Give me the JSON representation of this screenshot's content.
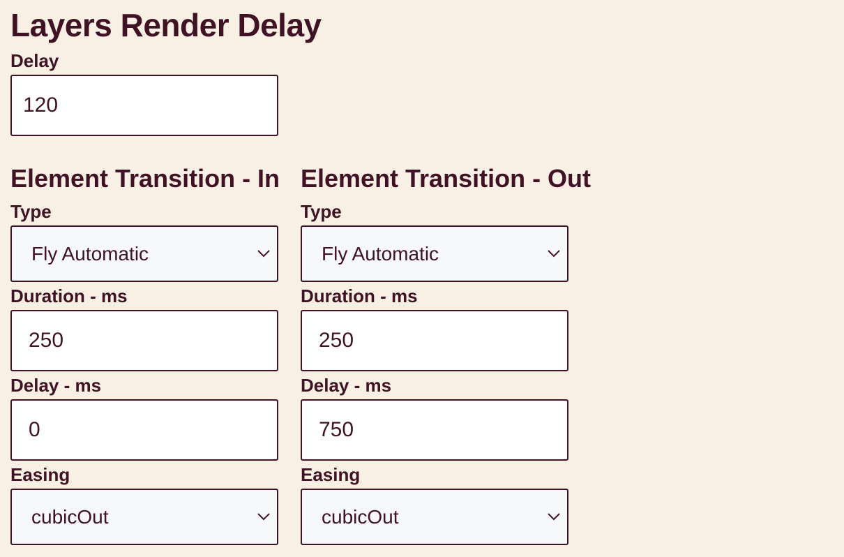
{
  "page_title": "Layers Render Delay",
  "render_delay": {
    "label": "Delay",
    "value": "120"
  },
  "transition_in": {
    "title": "Element Transition - In",
    "type_label": "Type",
    "type_value": "Fly Automatic",
    "duration_label": "Duration - ms",
    "duration_value": "250",
    "delay_label": "Delay - ms",
    "delay_value": "0",
    "easing_label": "Easing",
    "easing_value": "cubicOut"
  },
  "transition_out": {
    "title": "Element Transition - Out",
    "type_label": "Type",
    "type_value": "Fly Automatic",
    "duration_label": "Duration - ms",
    "duration_value": "250",
    "delay_label": "Delay - ms",
    "delay_value": "750",
    "easing_label": "Easing",
    "easing_value": "cubicOut"
  },
  "icons": {
    "dropdown": "chevron-down-icon"
  },
  "colors": {
    "background": "#f8efe5",
    "text": "#3f1224",
    "input_background": "#ffffff",
    "select_background": "#f6f8fa"
  }
}
